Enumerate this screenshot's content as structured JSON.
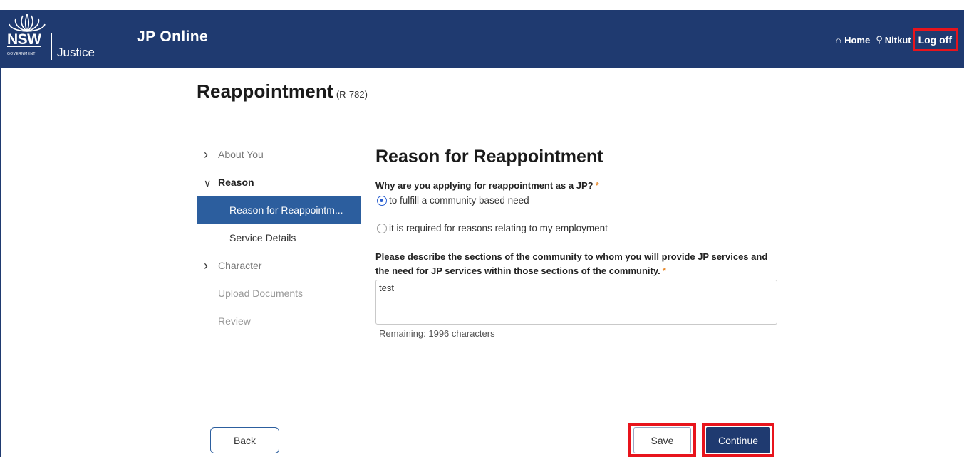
{
  "header": {
    "logo_top": "NSW",
    "logo_sub": "GOVERNMENT",
    "logo_dept": "Justice",
    "app_title": "JP Online",
    "nav": {
      "home_label": "Home",
      "user_name": "Nitkut",
      "logoff_label": "Log off"
    }
  },
  "page": {
    "title": "Reappointment",
    "code": "(R-782)"
  },
  "sidebar": {
    "items": [
      {
        "label": "About You"
      },
      {
        "label": "Reason"
      },
      {
        "label": "Reason for Reappointm..."
      },
      {
        "label": "Service Details"
      },
      {
        "label": "Character"
      },
      {
        "label": "Upload Documents"
      },
      {
        "label": "Review"
      }
    ]
  },
  "form": {
    "section_title": "Reason for Reappointment",
    "question1": "Why are you applying for reappointment as a JP?",
    "required_mark": "*",
    "options": [
      {
        "label": "to fulfill a community based need",
        "selected": true
      },
      {
        "label": "it is required for reasons relating to my employment",
        "selected": false
      }
    ],
    "question2": "Please describe the sections of the community to whom you will provide JP services and the need for JP services within those sections of the community.",
    "description_value": "test",
    "remaining_text": "Remaining: 1996 characters"
  },
  "actions": {
    "back_label": "Back",
    "save_label": "Save",
    "continue_label": "Continue"
  },
  "colors": {
    "header_bg": "#1f3a70",
    "active_nav": "#2c5e9e",
    "highlight_red": "#e8141c",
    "required_orange": "#e8892a"
  }
}
